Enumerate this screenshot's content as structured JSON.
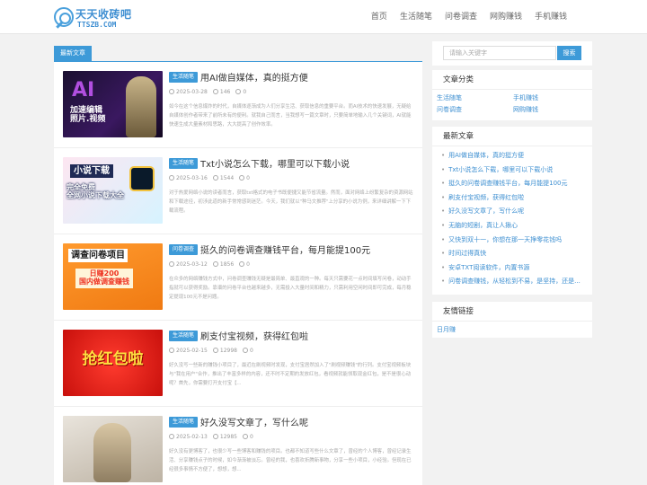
{
  "header": {
    "logo_cn": "天天收砖吧",
    "logo_en": "TTSZB.COM",
    "nav": [
      "首页",
      "生活随笔",
      "问卷调查",
      "网购赚钱",
      "手机赚钱"
    ]
  },
  "main": {
    "section_label": "最新文章",
    "posts": [
      {
        "category": "生活随笔",
        "title": "用AI做自媒体，真的挺方便",
        "date": "2025-03-28",
        "views": "146",
        "comments": "0",
        "excerpt": "如今在这个信息爆炸的时代，自媒体逐渐成为人们分享生活、获取信息的重要平台。而AI技术的快速发展，无疑给自媒体创作者带来了前所未有的便利。就我自己而言，当我想写一篇文章时，只要简单地输入几个关键词，AI就能快速生成大量素材和思路，大大提高了创作效率。",
        "thumb_text_1": "AI",
        "thumb_text_2": "加速编辑\n照片.视频"
      },
      {
        "category": "生活随笔",
        "title": "Txt小说怎么下载，哪里可以下载小说",
        "date": "2025-03-16",
        "views": "1544",
        "comments": "0",
        "excerpt": "对于热爱网络小说的读者而言，获取txt格式的电子书既便捷又能节省流量。然而，面对网络上纷繁复杂的资源网站和下载途径，初涉此道的新手常常感到迷茫。今天，我们就以\"种马文推荐\"上分享的小说为例，来详细讲解一下下载流程。",
        "thumb_text_1": "小说下载",
        "thumb_text_2": "完全免费\n全网小说下载大全"
      },
      {
        "category": "问卷调查",
        "title": "挺久的问卷调查赚钱平台，每月能提100元",
        "date": "2025-03-12",
        "views": "1856",
        "comments": "0",
        "excerpt": "在众多的网络赚钱方式中，问卷调查赚钱无疑是最简单、最直观的一种。每天只需要花一点时间填写问卷，动动手指就可以获得奖励。靠谱的问卷平台也越来越多，无需投入大量时间和精力，只需利用空闲时间即可完成，每月稳定提现100元不是问题。",
        "thumb_text_1": "调查问卷项目",
        "thumb_text_2": "日赚200\n国内做调查赚钱"
      },
      {
        "category": "生活随笔",
        "title": "刷支付宝视频，获得红包啦",
        "date": "2025-02-15",
        "views": "12998",
        "comments": "0",
        "excerpt": "好久没写一些新的赚钱小项目了，最近在刷视频时发现，支付宝居然加入了\"刷视频赚钱\"的行列。支付宝视频板块与\"我在用户\"合作，推出了丰富多样的内容，还不时不定期的发放红包，看视频就能领取现金红包，是不是很心动呢？首先，你需要打开支付宝【...",
        "thumb_text_1": "抢红包啦",
        "thumb_text_2": ""
      },
      {
        "category": "生活随笔",
        "title": "好久没写文章了，写什么呢",
        "date": "2025-02-13",
        "views": "12985",
        "comments": "0",
        "excerpt": "好久没有更博客了，也很少写一些博客和赚钱的项目。也都不知道写些什么文章了，曾经的个人博客，曾经记录生活、分享赚钱点子的时候，如今渐渐被淡忘。曾经的我，也喜欢折腾新事物，分享一些小项目，小经验。但现在已经很多事情不方便了，想想，想...",
        "thumb_text_1": "",
        "thumb_text_2": ""
      }
    ]
  },
  "sidebar": {
    "search_placeholder": "请输入关键字",
    "search_button": "搜索",
    "categories_title": "文章分类",
    "categories": [
      "生活随笔",
      "手机赚钱",
      "问卷调查",
      "网购赚钱"
    ],
    "recent_title": "最新文章",
    "recent": [
      "用AI做自媒体，真的挺方便",
      "Txt小说怎么下载，哪里可以下载小说",
      "挺久的问卷调查赚钱平台，每月能提100元",
      "刷支付宝视频，获得红包啦",
      "好久没写文章了，写什么呢",
      "无脑的短剧，真让人揪心",
      "又快到双十一，你想在那一天挣零花钱吗",
      "时间过得真快",
      "安卓TXT阅读软件，内置书源",
      "问卷调查赚钱，从轻松到不易，是坚持，还是..."
    ],
    "links_title": "友情链接",
    "links": [
      "日月赚"
    ]
  }
}
